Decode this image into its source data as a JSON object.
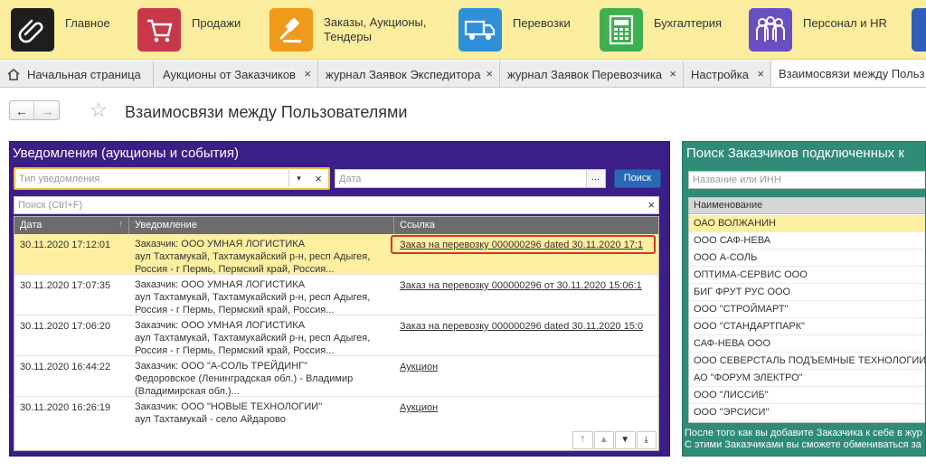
{
  "sections": [
    {
      "label": "Главное",
      "icon": "paperclip-icon",
      "color": "#1e1e1e"
    },
    {
      "label": "Продажи",
      "icon": "shopping-cart-icon",
      "color": "#c8384a"
    },
    {
      "label": "Заказы, Аукционы,\nТендеры",
      "icon": "gavel-icon",
      "color": "#ef9a1a"
    },
    {
      "label": "Перевозки",
      "icon": "truck-icon",
      "color": "#2f8fd9"
    },
    {
      "label": "Бухгалтерия",
      "icon": "calculator-icon",
      "color": "#3fae4f"
    },
    {
      "label": "Персонал и HR",
      "icon": "people-icon",
      "color": "#6a4fc0"
    }
  ],
  "tabs": [
    {
      "label": "Начальная страница",
      "home": true
    },
    {
      "label": "Аукционы от Заказчиков",
      "close": "×"
    },
    {
      "label": "журнал Заявок Экспедитора",
      "close": "×"
    },
    {
      "label": "журнал Заявок Перевозчика",
      "close": "×"
    },
    {
      "label": "Настройка",
      "close": "×"
    },
    {
      "label": "Взаимосвязи между Польз",
      "active": true
    }
  ],
  "nav": {
    "back": "←",
    "forward": "→",
    "star": "☆"
  },
  "page_title": "Взаимосвязи между Пользователями",
  "notifications": {
    "title": "Уведомления (аукционы и события)",
    "type_placeholder": "Тип уведомления",
    "date_placeholder": "Дата",
    "search_button": "Поиск",
    "quick_search_placeholder": "Поиск (Ctrl+F)",
    "dropdown_symbol": "▾",
    "clear_symbol": "×",
    "dots": "...",
    "columns": [
      "Дата",
      "Уведомление",
      "Ссылка"
    ],
    "rows": [
      {
        "date": "30.11.2020 17:12:01",
        "lines": [
          "Заказчик: ООО УМНАЯ ЛОГИСТИКА",
          "аул Тахтамукай, Тахтамукайский р-н, респ Адыгея,",
          "Россия - г Пермь, Пермский край, Россия..."
        ],
        "link": "Заказ на перевозку 000000296 dated 30.11.2020 17:1",
        "selected": true
      },
      {
        "date": "30.11.2020 17:07:35",
        "lines": [
          "Заказчик: ООО УМНАЯ ЛОГИСТИКА",
          "аул Тахтамукай, Тахтамукайский р-н, респ Адыгея,",
          "Россия - г Пермь, Пермский край, Россия..."
        ],
        "link": "Заказ на перевозку 000000296 от 30.11.2020 15:06:1"
      },
      {
        "date": "30.11.2020 17:06:20",
        "lines": [
          "Заказчик: ООО УМНАЯ ЛОГИСТИКА",
          "аул Тахтамукай, Тахтамукайский р-н, респ Адыгея,",
          "Россия - г Пермь, Пермский край, Россия..."
        ],
        "link": "Заказ на перевозку 000000296 dated 30.11.2020 15:0"
      },
      {
        "date": "30.11.2020 16:44:22",
        "lines": [
          "Заказчик: ООО \"А-СОЛЬ ТРЕЙДИНГ\"",
          "Федоровское (Ленинградская обл.) - Владимир",
          "(Владимирская обл.)..."
        ],
        "link": "Аукцион"
      },
      {
        "date": "30.11.2020 16:26:19",
        "lines": [
          "Заказчик: ООО \"НОВЫЕ ТЕХНОЛОГИИ\"",
          "аул Тахтамукай - село Айдарово"
        ],
        "link": "Аукцион"
      }
    ]
  },
  "customers": {
    "title": "Поиск Заказчиков подключенных к",
    "search_placeholder": "Название или ИНН",
    "column": "Наименование",
    "rows": [
      "ОАО ВОЛЖАНИН",
      "ООО САФ-НЕВА",
      "ООО А-СОЛЬ",
      "ОПТИМА-СЕРВИС ООО",
      "БИГ ФРУТ РУС ООО",
      "ООО \"СТРОЙМАРТ\"",
      "ООО \"СТАНДАРТПАРК\"",
      "САФ-НЕВА ООО",
      "ООО СЕВЕРСТАЛЬ ПОДЪЕМНЫЕ ТЕХНОЛОГИИ",
      "АО \"ФОРУМ ЭЛЕКТРО\"",
      "ООО \"ЛИССИБ\"",
      "ООО \"ЭРСИСИ\""
    ],
    "note": [
      "После того как вы добавите Заказчика к себе в жур",
      "С этими Заказчиками вы сможете обмениваться за"
    ]
  }
}
